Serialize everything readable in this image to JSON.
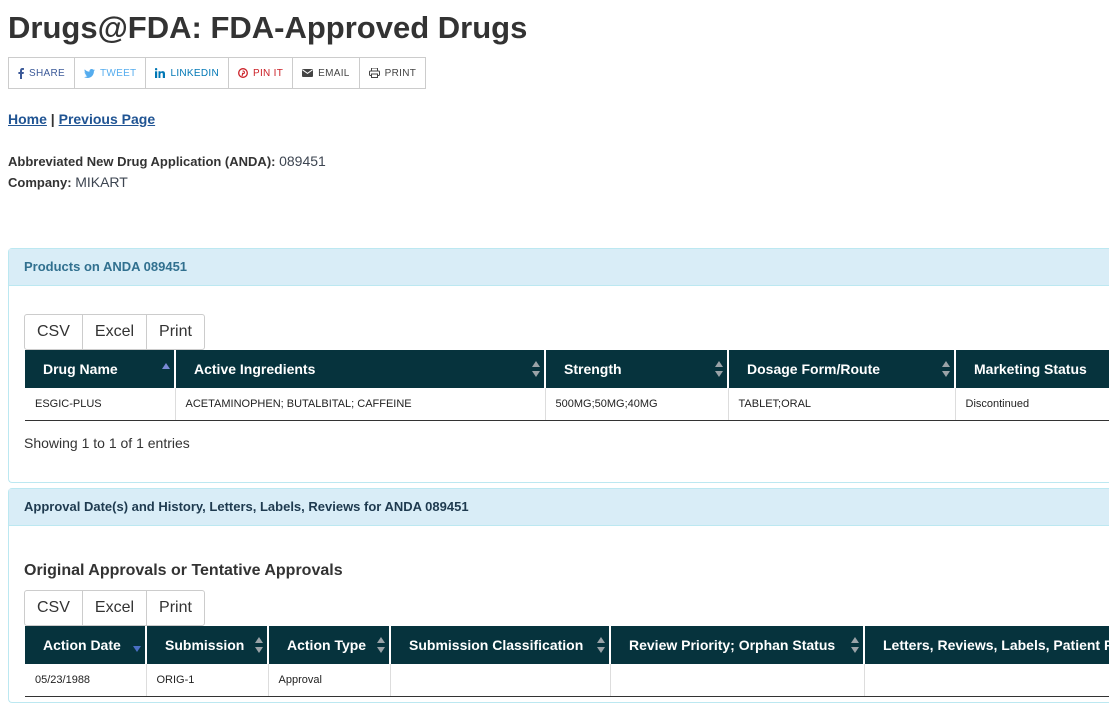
{
  "page": {
    "title": "Drugs@FDA: FDA-Approved Drugs"
  },
  "share": {
    "share": "SHARE",
    "tweet": "TWEET",
    "linkedin": "LINKEDIN",
    "pin": "PIN IT",
    "email": "EMAIL",
    "print": "PRINT"
  },
  "breadcrumb": {
    "home": "Home",
    "sep": "|",
    "previous": "Previous Page"
  },
  "application": {
    "label": "Abbreviated New Drug Application (ANDA):",
    "number": "089451",
    "company_label": "Company:",
    "company": "MIKART"
  },
  "products": {
    "heading": "Products on ANDA 089451",
    "buttons": [
      "CSV",
      "Excel",
      "Print"
    ],
    "columns": [
      "Drug Name",
      "Active Ingredients",
      "Strength",
      "Dosage Form/Route",
      "Marketing Status"
    ],
    "rows": [
      [
        "ESGIC-PLUS",
        "ACETAMINOPHEN; BUTALBITAL; CAFFEINE",
        "500MG;50MG;40MG",
        "TABLET;ORAL",
        "Discontinued"
      ]
    ],
    "info": "Showing 1 to 1 of 1 entries"
  },
  "history": {
    "heading": "Approval Date(s) and History, Letters, Labels, Reviews for ANDA 089451",
    "subheading": "Original Approvals or Tentative Approvals",
    "buttons": [
      "CSV",
      "Excel",
      "Print"
    ],
    "columns": [
      "Action Date",
      "Submission",
      "Action Type",
      "Submission Classification",
      "Review Priority; Orphan Status",
      "Letters, Reviews, Labels, Patient P"
    ],
    "rows": [
      [
        "05/23/1988",
        "ORIG-1",
        "Approval",
        "",
        "",
        ""
      ]
    ]
  }
}
